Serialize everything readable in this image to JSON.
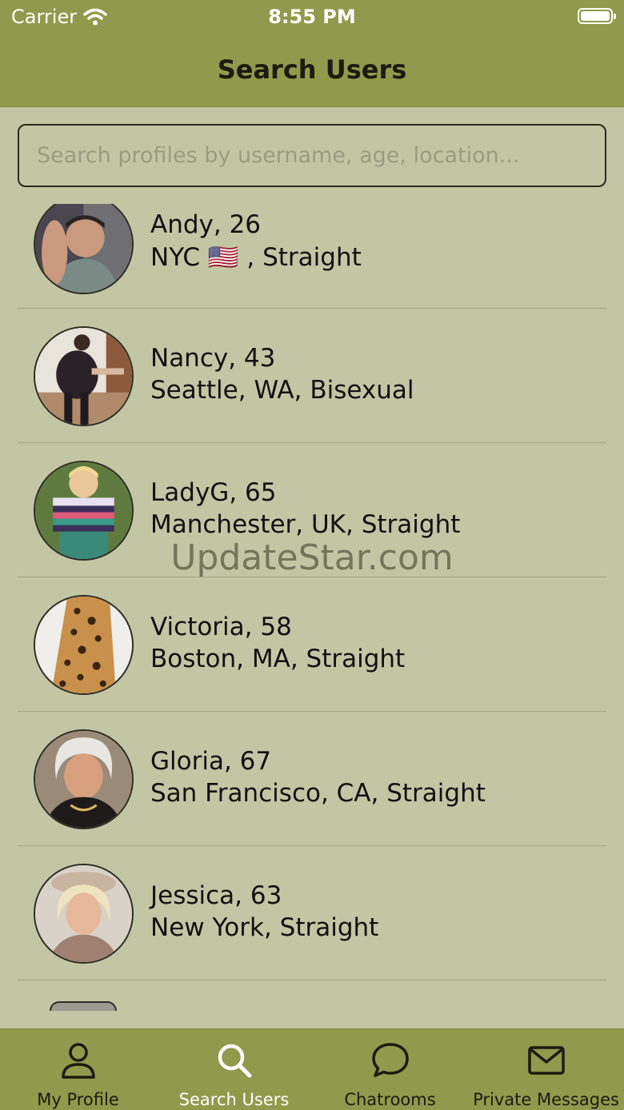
{
  "status_bar": {
    "carrier": "Carrier",
    "time": "8:55 PM"
  },
  "nav": {
    "title": "Search Users"
  },
  "search": {
    "placeholder": "Search profiles by username, age, location..."
  },
  "users": [
    {
      "name": "Andy, 26",
      "info": "NYC 🇺🇸 , Straight"
    },
    {
      "name": "Nancy, 43",
      "info": "Seattle, WA, Bisexual"
    },
    {
      "name": "LadyG, 65",
      "info": "Manchester, UK, Straight"
    },
    {
      "name": "Victoria, 58",
      "info": "Boston, MA, Straight"
    },
    {
      "name": "Gloria, 67",
      "info": "San Francisco, CA, Straight"
    },
    {
      "name": "Jessica, 63",
      "info": "New York, Straight"
    }
  ],
  "watermark": "UpdateStar.com",
  "tabs": [
    {
      "label": "My Profile",
      "icon": "person-icon",
      "active": false
    },
    {
      "label": "Search Users",
      "icon": "search-icon",
      "active": true
    },
    {
      "label": "Chatrooms",
      "icon": "chat-bubble-icon",
      "active": false
    },
    {
      "label": "Private Messages",
      "icon": "envelope-icon",
      "active": false
    }
  ],
  "colors": {
    "bar": "#8f9a4c",
    "background": "#c3c6a4",
    "active_tab": "#ffffff"
  }
}
